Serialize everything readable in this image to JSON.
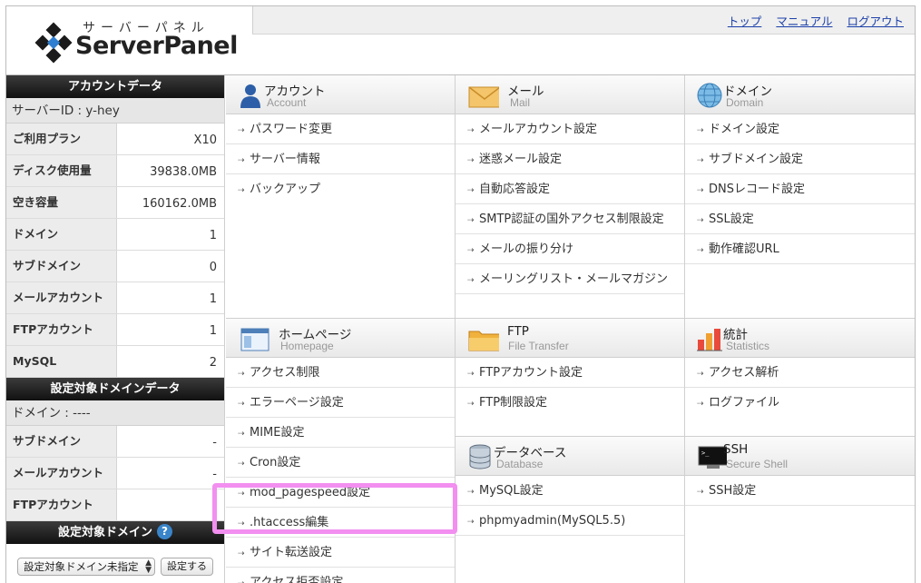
{
  "logo": {
    "kana": "サーバーパネル",
    "brand": "ServerPanel"
  },
  "top_links": [
    "トップ",
    "マニュアル",
    "ログアウト"
  ],
  "account_data": {
    "title": "アカウントデータ",
    "server_id": "サーバーID : y-hey",
    "rows": [
      {
        "label": "ご利用プラン",
        "value": "X10"
      },
      {
        "label": "ディスク使用量",
        "value": "39838.0MB"
      },
      {
        "label": "空き容量",
        "value": "160162.0MB"
      },
      {
        "label": "ドメイン",
        "value": "1"
      },
      {
        "label": "サブドメイン",
        "value": "0"
      },
      {
        "label": "メールアカウント",
        "value": "1"
      },
      {
        "label": "FTPアカウント",
        "value": "1"
      },
      {
        "label": "MySQL",
        "value": "2"
      }
    ]
  },
  "target_domain_data": {
    "title": "設定対象ドメインデータ",
    "domain": "ドメイン : ----",
    "rows": [
      {
        "label": "サブドメイン",
        "value": "-"
      },
      {
        "label": "メールアカウント",
        "value": "-"
      },
      {
        "label": "FTPアカウント",
        "value": "-"
      }
    ]
  },
  "target_domain": {
    "title": "設定対象ドメイン",
    "help": "?",
    "select_value": "設定対象ドメイン未指定",
    "button": "設定する"
  },
  "sections": {
    "account": {
      "title": "アカウント",
      "subtitle": "Account",
      "items": [
        "パスワード変更",
        "サーバー情報",
        "バックアップ"
      ]
    },
    "mail": {
      "title": "メール",
      "subtitle": "Mail",
      "items": [
        "メールアカウント設定",
        "迷惑メール設定",
        "自動応答設定",
        "SMTP認証の国外アクセス制限設定",
        "メールの振り分け",
        "メーリングリスト・メールマガジン"
      ]
    },
    "domain": {
      "title": "ドメイン",
      "subtitle": "Domain",
      "items": [
        "ドメイン設定",
        "サブドメイン設定",
        "DNSレコード設定",
        "SSL設定",
        "動作確認URL"
      ]
    },
    "homepage": {
      "title": "ホームページ",
      "subtitle": "Homepage",
      "items": [
        "アクセス制限",
        "エラーページ設定",
        "MIME設定",
        "Cron設定",
        "mod_pagespeed設定",
        ".htaccess編集",
        "サイト転送設定",
        "アクセス拒否設定"
      ]
    },
    "ftp": {
      "title": "FTP",
      "subtitle": "File Transfer",
      "items": [
        "FTPアカウント設定",
        "FTP制限設定"
      ]
    },
    "stats": {
      "title": "統計",
      "subtitle": "Statistics",
      "items": [
        "アクセス解析",
        "ログファイル"
      ]
    },
    "database": {
      "title": "データベース",
      "subtitle": "Database",
      "items": [
        "MySQL設定",
        "phpmyadmin(MySQL5.5)"
      ]
    },
    "ssh": {
      "title": "SSH",
      "subtitle": "Secure Shell",
      "items": [
        "SSH設定"
      ]
    }
  },
  "colors": {
    "link": "#1a3fa8",
    "highlight": "#f28ff0",
    "header_dark": "#111111",
    "help_icon": "#3a85c9"
  }
}
